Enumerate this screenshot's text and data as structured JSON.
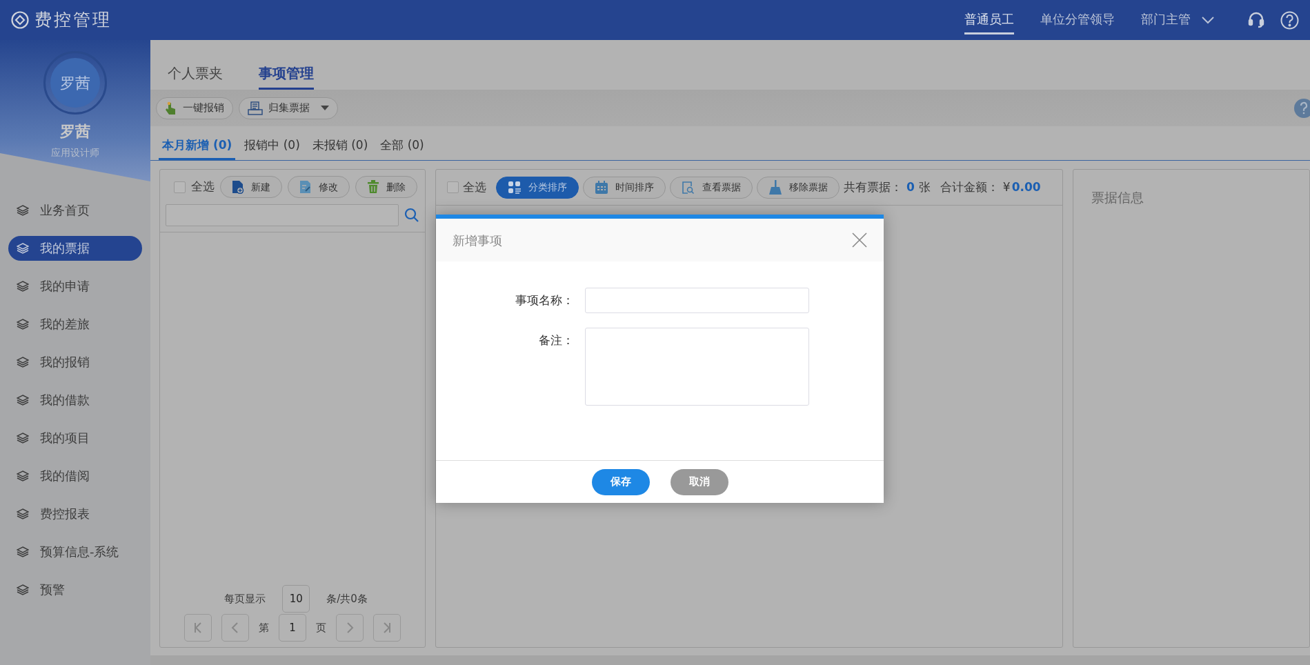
{
  "header": {
    "logo_text": "费控管理",
    "roles": [
      {
        "label": "普通员工",
        "selected": true
      },
      {
        "label": "单位分管领导",
        "selected": false
      },
      {
        "label": "部门主管",
        "selected": false
      }
    ]
  },
  "sidebar": {
    "user": {
      "avatar_text": "罗茜",
      "name": "罗茜",
      "title": "应用设计师"
    },
    "items": [
      {
        "label": "业务首页",
        "selected": false
      },
      {
        "label": "我的票据",
        "selected": true
      },
      {
        "label": "我的申请",
        "selected": false
      },
      {
        "label": "我的差旅",
        "selected": false
      },
      {
        "label": "我的报销",
        "selected": false
      },
      {
        "label": "我的借款",
        "selected": false
      },
      {
        "label": "我的项目",
        "selected": false
      },
      {
        "label": "我的借阅",
        "selected": false
      },
      {
        "label": "费控报表",
        "selected": false
      },
      {
        "label": "预算信息-系统",
        "selected": false
      },
      {
        "label": "预警",
        "selected": false
      }
    ]
  },
  "main_tabs": [
    {
      "label": "个人票夹",
      "selected": false
    },
    {
      "label": "事项管理",
      "selected": true
    }
  ],
  "toolbar": [
    {
      "label": "一键报销",
      "has_menu": false
    },
    {
      "label": "归集票据",
      "has_menu": true
    }
  ],
  "sub_tabs": [
    {
      "label": "本月新增 (0)",
      "selected": true
    },
    {
      "label": "报销中 (0)",
      "selected": false
    },
    {
      "label": "未报销 (0)",
      "selected": false
    },
    {
      "label": "全部 (0)",
      "selected": false
    }
  ],
  "left_panel": {
    "select_all": {
      "label": "全选",
      "checked": false
    },
    "buttons": [
      "新建",
      "修改",
      "删除"
    ],
    "pagination": {
      "per_page_label": "每页显示",
      "per_page": "10",
      "total": "条/共0条",
      "page_label": "第",
      "page": "1",
      "page_unit": "页"
    }
  },
  "middle_panel": {
    "select_all": {
      "label": "全选",
      "checked": false
    },
    "buttons": [
      {
        "label": "分类排序",
        "selected": true
      },
      {
        "label": "时间排序",
        "selected": false
      },
      {
        "label": "查看票据",
        "selected": false
      },
      {
        "label": "移除票据",
        "selected": false
      }
    ],
    "summary": {
      "count_label": "共有票据：",
      "count": "0",
      "count_unit": "张",
      "amount_label": "合计金额：",
      "currency": "¥",
      "amount": "0.00"
    }
  },
  "right_panel": {
    "title": "票据信息"
  },
  "dialog": {
    "title": "新增事项",
    "fields": [
      {
        "label": "事项名称：",
        "kind": "input"
      },
      {
        "label": "备注：",
        "kind": "textarea"
      }
    ],
    "buttons": [
      {
        "label": "保存",
        "kind": "primary"
      },
      {
        "label": "取消",
        "kind": "secondary"
      }
    ]
  }
}
